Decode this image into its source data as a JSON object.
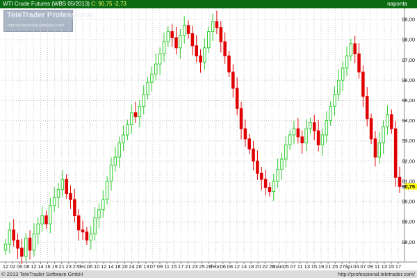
{
  "header": {
    "instrument": "WTI Crude Futures (WBS 05/2013)",
    "price_label": "C: 90,75 -2,73",
    "period": "napontа"
  },
  "logo": {
    "name": "TeleTrader Professional",
    "url": "http://professional.teletrader.com/"
  },
  "footer": {
    "copyright": "© 2013 TeleTrader Software GmbH",
    "url": "http://professional.teletrader.com/"
  },
  "colors": {
    "background": "#ffffff",
    "header_bg": "#0b6b12",
    "up_candle": "#2ecc2e",
    "down_candle": "#e00000",
    "grid": "#c8c8c8",
    "last_price_bg": "#ffff00"
  },
  "chart_data": {
    "type": "candlestick",
    "y_ticks": [
      88,
      89,
      90,
      91,
      92,
      93,
      94,
      95,
      96,
      97,
      98,
      99
    ],
    "y_tick_labels": [
      "88,00",
      "89,00",
      "90,00",
      "91,00",
      "92,00",
      "93,00",
      "94,00",
      "95,00",
      "96,00",
      "97,00",
      "98,00",
      "99,00"
    ],
    "ylim": [
      87.05,
      99.55
    ],
    "last_price": 90.75,
    "last_price_label": "90,75",
    "grid": true,
    "x_tick_labels": [
      "12",
      "02",
      "06",
      "08",
      "12",
      "14",
      "16",
      "19",
      "21",
      "23",
      "27",
      "dec.",
      "06",
      "10",
      "12",
      "14",
      "18",
      "20",
      "24",
      "26",
      "'13",
      "07",
      "09",
      "11",
      "15",
      "17",
      "21",
      "23",
      "25",
      "28",
      "febr.",
      "06",
      "08",
      "12",
      "14",
      "18",
      "20",
      "22",
      "26",
      "márc.",
      "05",
      "07",
      "11",
      "13",
      "15",
      "19",
      "21",
      "25",
      "27",
      "ápr.",
      "04",
      "07",
      "09",
      "11",
      "13",
      "15",
      "17"
    ],
    "closes": [
      87.9,
      88.6,
      88.1,
      87.7,
      87.3,
      88.2,
      87.6,
      88.4,
      88.9,
      89.3,
      88.9,
      89.8,
      90.2,
      90.6,
      91.1,
      90.4,
      90.1,
      89.3,
      88.6,
      88.5,
      88.1,
      88.4,
      89.2,
      89.6,
      90.1,
      91.0,
      91.8,
      92.2,
      92.9,
      93.3,
      93.8,
      94.4,
      94.2,
      94.7,
      95.3,
      95.9,
      96.3,
      96.8,
      97.3,
      97.9,
      98.4,
      98.1,
      97.6,
      98.2,
      98.7,
      98.3,
      97.7,
      97.2,
      96.9,
      97.6,
      98.4,
      98.9,
      98.6,
      97.9,
      97.2,
      96.4,
      95.6,
      94.6,
      93.6,
      93.1,
      92.6,
      92.0,
      91.4,
      91.1,
      90.7,
      90.5,
      91.0,
      91.6,
      92.1,
      92.8,
      93.3,
      93.6,
      93.2,
      92.9,
      93.6,
      93.9,
      93.5,
      92.8,
      93.3,
      94.0,
      94.7,
      95.3,
      96.0,
      96.6,
      97.2,
      97.8,
      97.3,
      96.4,
      95.2,
      94.1,
      93.1,
      92.2,
      92.9,
      93.7,
      94.3,
      93.6,
      91.2,
      90.75
    ]
  }
}
